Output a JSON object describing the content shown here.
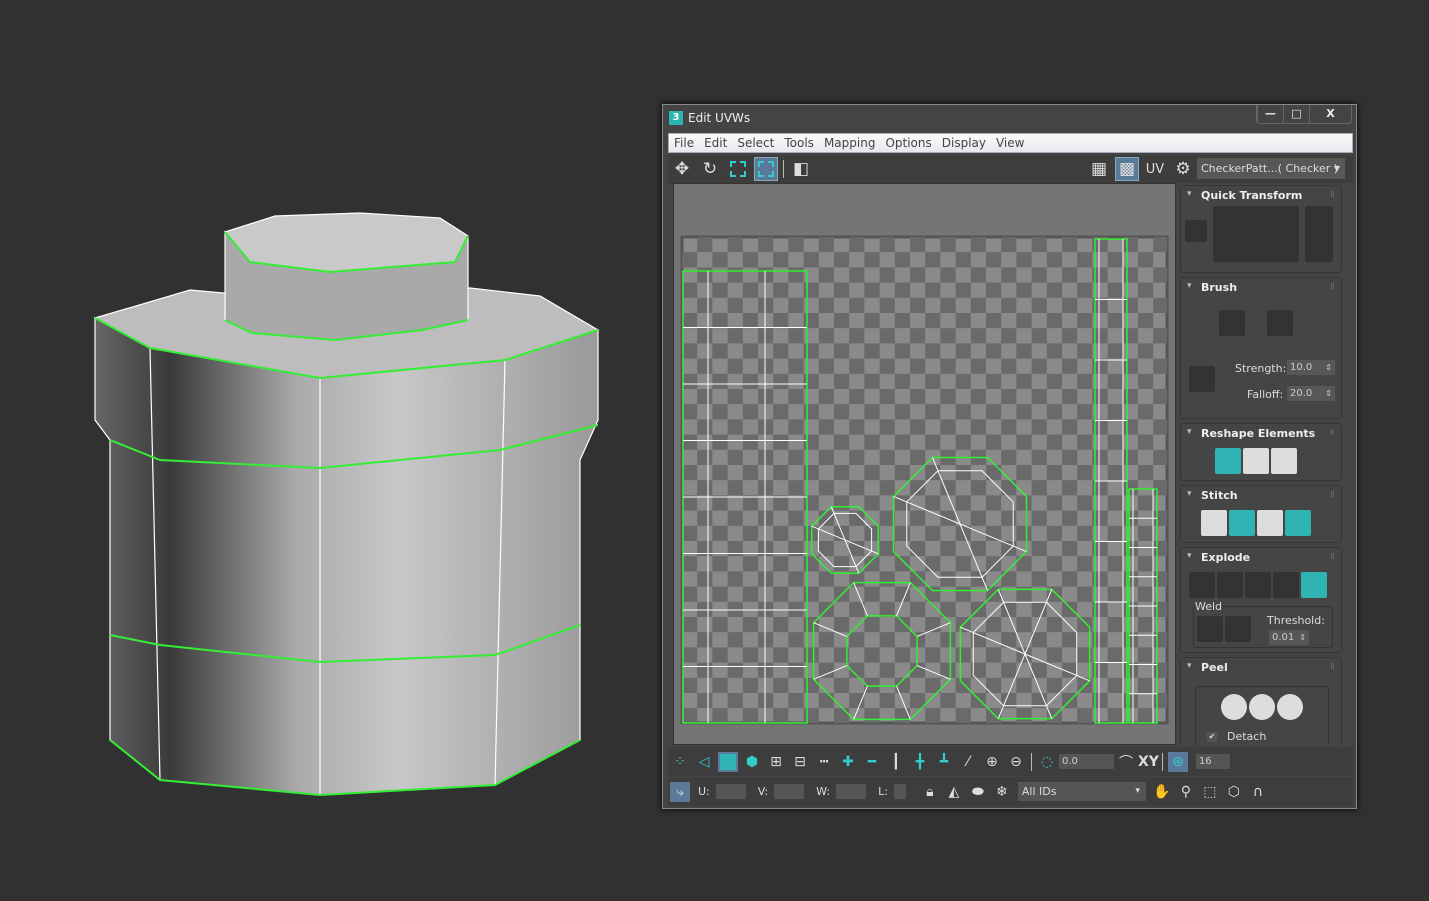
{
  "window": {
    "title": "Edit UVWs",
    "app_icon": "3",
    "controls": {
      "minimize": "—",
      "maximize": "□",
      "close": "X"
    }
  },
  "menu": [
    "File",
    "Edit",
    "Select",
    "Tools",
    "Mapping",
    "Options",
    "Display",
    "View"
  ],
  "toolbar": {
    "uv_label": "UV",
    "texture_dropdown": "CheckerPatt...( Checker )"
  },
  "rollouts": {
    "quick_transform": {
      "title": "Quick Transform"
    },
    "brush": {
      "title": "Brush",
      "strength_label": "Strength:",
      "strength": "10.0",
      "falloff_label": "Falloff:",
      "falloff": "20.0"
    },
    "reshape": {
      "title": "Reshape Elements"
    },
    "stitch": {
      "title": "Stitch"
    },
    "explode": {
      "title": "Explode",
      "weld_label": "Weld",
      "threshold_label": "Threshold:",
      "threshold": "0.01"
    },
    "peel": {
      "title": "Peel",
      "detach_label": "Detach",
      "detach_checked": true
    }
  },
  "bottom": {
    "rotate_value": "0.0",
    "xy_label": "XY",
    "snap_value": "16",
    "u_label": "U:",
    "v_label": "V:",
    "w_label": "W:",
    "l_label": "L:",
    "ids_dropdown": "All IDs"
  },
  "colors": {
    "accent": "#2fb3b3",
    "seam": "#33dd33",
    "background": "#313131"
  }
}
